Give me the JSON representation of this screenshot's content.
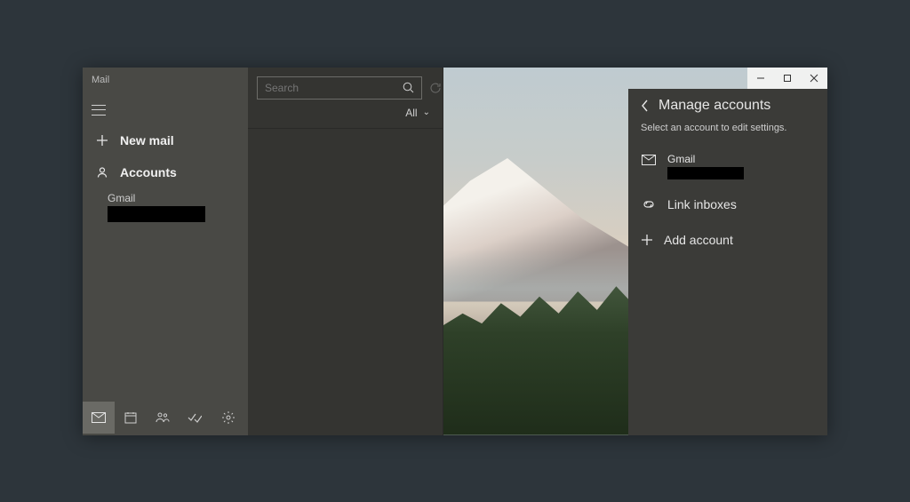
{
  "app": {
    "title": "Mail"
  },
  "sidebar": {
    "new_mail": "New mail",
    "accounts_header": "Accounts",
    "accounts": [
      {
        "name": "Gmail",
        "address": ""
      }
    ]
  },
  "search": {
    "placeholder": "Search"
  },
  "filter": {
    "label": "All"
  },
  "manage_panel": {
    "title": "Manage accounts",
    "subtitle": "Select an account to edit settings.",
    "accounts": [
      {
        "name": "Gmail",
        "address": ""
      }
    ],
    "link_inboxes": "Link inboxes",
    "add_account": "Add account"
  }
}
